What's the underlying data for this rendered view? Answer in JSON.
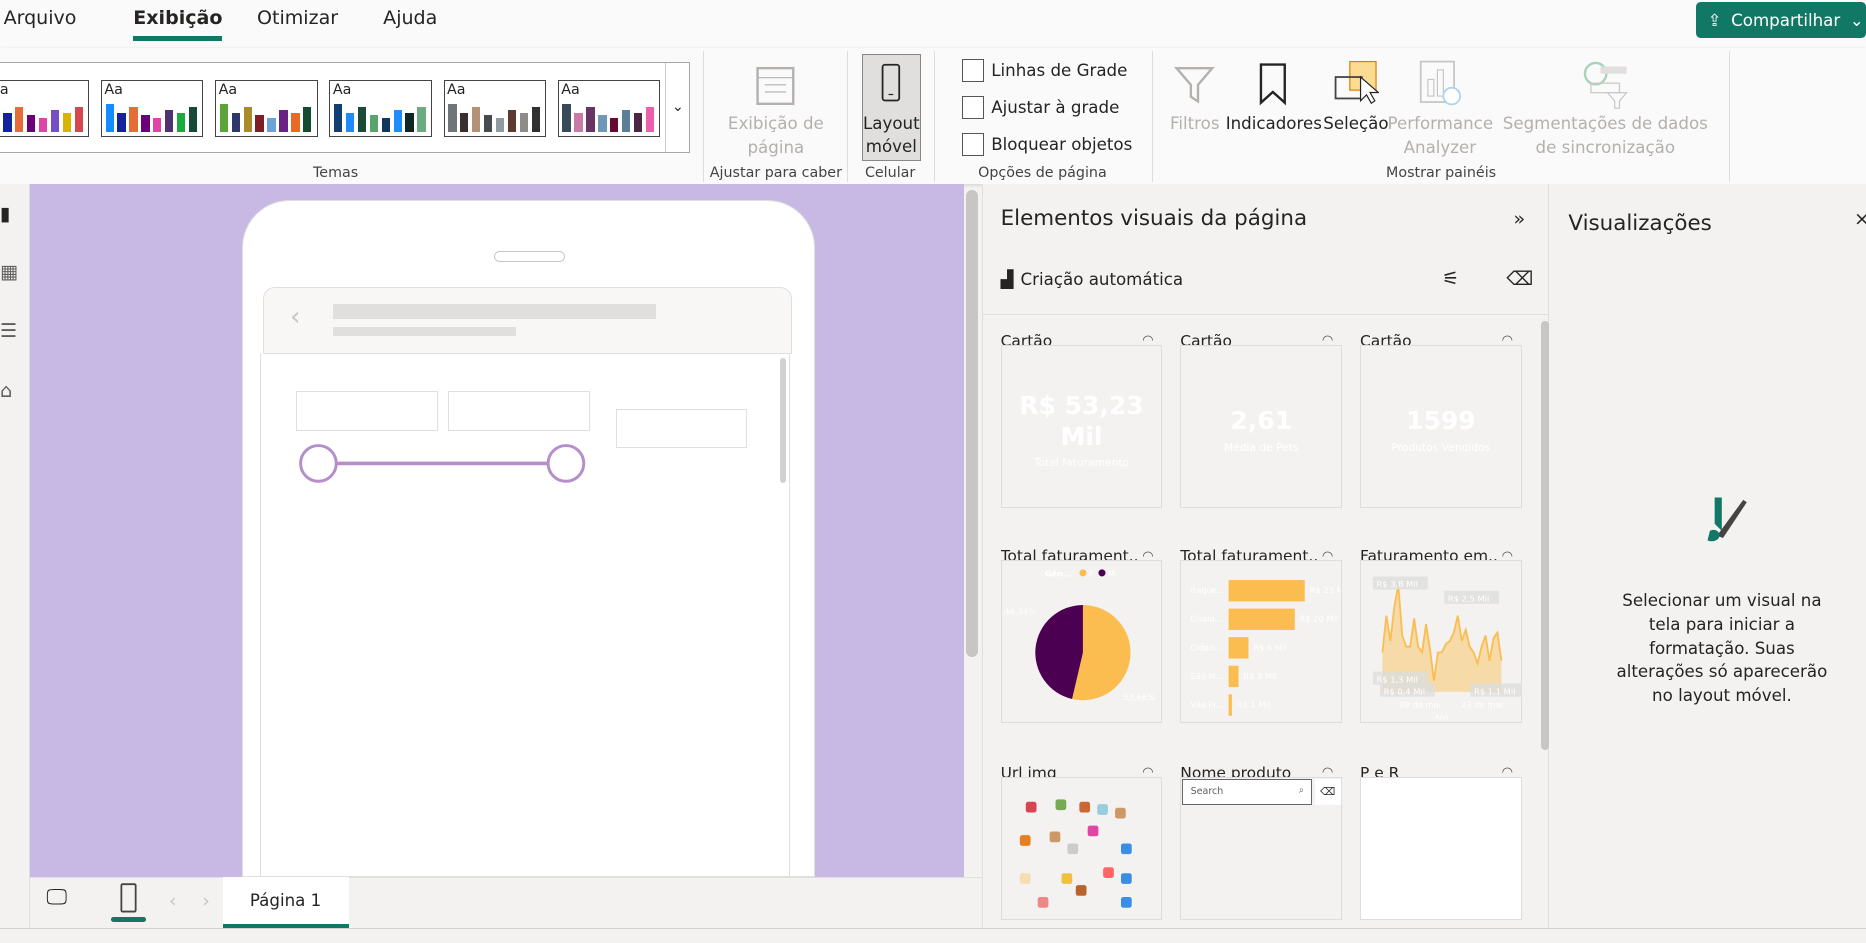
{
  "menu": {
    "tabs": [
      "Arquivo",
      "Exibição",
      "Otimizar",
      "Ajuda"
    ],
    "active": "Exibição",
    "share_label": "Compartilhar"
  },
  "ribbon": {
    "themes_label": "Temas",
    "themes": [
      [
        "#118dff",
        "#12239e",
        "#e66c37",
        "#6b007b",
        "#e044a7",
        "#744ec2",
        "#d9b300",
        "#d64550"
      ],
      [
        "#118dff",
        "#12239e",
        "#e66c37",
        "#6b007b",
        "#e044a7",
        "#4f3371",
        "#1aab40",
        "#15493a"
      ],
      [
        "#59a53a",
        "#2f3669",
        "#aa8a29",
        "#7f1d25",
        "#6ba2d8",
        "#6a2384",
        "#e76b25",
        "#154b2f"
      ],
      [
        "#12406e",
        "#1e8bff",
        "#1c4a38",
        "#5ba36e",
        "#12365e",
        "#1e8bff",
        "#0e2624",
        "#6bad80"
      ],
      [
        "#6e7679",
        "#3b2f2d",
        "#b59177",
        "#464c4e",
        "#8f9ba0",
        "#5d3a31",
        "#8c8c88",
        "#303030"
      ],
      [
        "#374a5a",
        "#c87ba7",
        "#683466",
        "#6f97b8",
        "#690933",
        "#5b7f98",
        "#4b2645",
        "#ec5fac"
      ]
    ],
    "page_view": {
      "label": "Exibição de página",
      "group": "Ajustar para caber"
    },
    "mobile": {
      "label": "Layout móvel",
      "group": "Celular"
    },
    "page_options": {
      "group": "Opções de página",
      "checkboxes": [
        {
          "label": "Linhas de Grade",
          "checked": false
        },
        {
          "label": "Ajustar à grade",
          "checked": false
        },
        {
          "label": "Bloquear objetos",
          "checked": false
        }
      ]
    },
    "panes": {
      "group": "Mostrar painéis",
      "buttons": [
        {
          "label": "Filtros",
          "enabled": false
        },
        {
          "label": "Indicadores",
          "enabled": true
        },
        {
          "label": "Seleção",
          "enabled": true
        },
        {
          "label": "Performance Analyzer",
          "enabled": false
        },
        {
          "label": "Segmentações de dados de sincronização",
          "enabled": false
        }
      ]
    }
  },
  "pages": {
    "tabs": [
      "Página 1"
    ]
  },
  "visuals_panel": {
    "title": "Elementos visuais da página",
    "auto_create": "Criação automática",
    "cards": [
      {
        "title": "Cartão",
        "value": "R$ 53,23 Mil",
        "label": "Total faturamento"
      },
      {
        "title": "Cartão",
        "value": "2,61",
        "label": "Média de Pets"
      },
      {
        "title": "Cartão",
        "value": "1599",
        "label": "Produtos Vendidos"
      }
    ],
    "row2_titles": [
      "Total faturament...",
      "Total faturament...",
      "Faturamento em..."
    ],
    "row3_titles": [
      "Url img",
      "Nome produto",
      "P e R"
    ],
    "search_placeholder": "Search"
  },
  "chart_data": [
    {
      "type": "pie",
      "legend_title": "Gên...",
      "legend_placement": "top",
      "slices": [
        {
          "name": "F",
          "value": 53.66,
          "label": "53,66%",
          "color": "#fbbd4f"
        },
        {
          "name": "M",
          "value": 46.34,
          "label": "46,34%",
          "color": "#4b0052"
        }
      ]
    },
    {
      "type": "bar",
      "orientation": "horizontal",
      "categories": [
        "Itaque...",
        "Guaia...",
        "Cidad...",
        "São M...",
        "Vila Pr..."
      ],
      "values": [
        23,
        20,
        6,
        3,
        1
      ],
      "labels": [
        "R$ 23 Mil",
        "R$ 20 Mil",
        "R$ 6 Mil",
        "R$ 3 Mil",
        "R$ 1 Mil"
      ],
      "color": "#fbbd4f"
    },
    {
      "type": "area",
      "xlabel": "Ano",
      "xticks": [
        "09 de mai",
        "23 de mai"
      ],
      "color": "#fbbd4f",
      "values": [
        1.4,
        2.7,
        1.8,
        3.0,
        3.8,
        2.0,
        1.6,
        1.6,
        2.6,
        1.6,
        1.4,
        2.4,
        1.5,
        0.4,
        1.4,
        1.4,
        1.7,
        1.8,
        2.1,
        2.7,
        1.8,
        2.2,
        1.6,
        1.4,
        1.0,
        1.6,
        2.0,
        1.1,
        1.9,
        2.1,
        1.1
      ],
      "annotations": [
        "R$ 3,8 Mil",
        "R$ 2,5 Mil",
        "R$ 1,3 Mil",
        "R$ 0,4 Mil",
        "R$ 1,1 Mil"
      ]
    }
  ],
  "viz_panel": {
    "title": "Visualizações",
    "hint": "Selecionar um visual na tela para iniciar a formatação. Suas alterações só aparecerão no layout móvel."
  }
}
